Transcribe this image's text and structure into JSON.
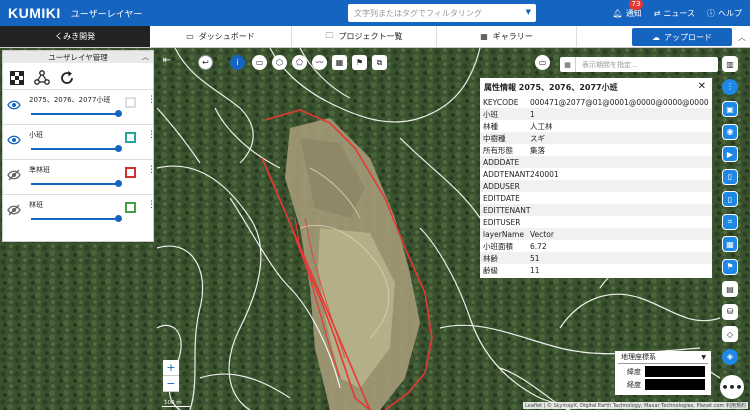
{
  "header": {
    "logo": "KUMIKI",
    "app_name": "ユーザーレイヤー",
    "search_placeholder": "文字列またはタグでフィルタリング",
    "notification_label": "通知",
    "notification_count": "73",
    "news_label": "ニュース",
    "help_label": "ヘルプ"
  },
  "nav": {
    "project": "くみき開発",
    "tabs": [
      {
        "label": "ダッシュボード",
        "icon": "monitor-icon"
      },
      {
        "label": "プロジェクト一覧",
        "icon": "folder-icon"
      },
      {
        "label": "ギャラリー",
        "icon": "grid-icon"
      }
    ],
    "upload_label": "アップロード"
  },
  "layer_panel": {
    "title": "ユーザレイヤ管理",
    "layers": [
      {
        "name": "2075、2076、2077小班",
        "visible": true,
        "color": "#dddddd",
        "opacity": 1.0
      },
      {
        "name": "小班",
        "visible": true,
        "color": "#26a69a",
        "opacity": 1.0
      },
      {
        "name": "準林班",
        "visible": false,
        "color": "#d32f2f",
        "opacity": 1.0
      },
      {
        "name": "林班",
        "visible": false,
        "color": "#43a047",
        "opacity": 1.0
      }
    ]
  },
  "map_toolbar": {
    "period_placeholder": "表示期間を指定..."
  },
  "attributes": {
    "title": "属性情報 2075、2076、2077小班",
    "rows": [
      {
        "key": "KEYCODE",
        "value": "000471@2077@01@0001@0000@0000@0000"
      },
      {
        "key": "小班",
        "value": "1"
      },
      {
        "key": "林種",
        "value": "人工林"
      },
      {
        "key": "中樹種",
        "value": "スギ"
      },
      {
        "key": "所有形態",
        "value": "集落"
      },
      {
        "key": "ADDDATE",
        "value": ""
      },
      {
        "key": "ADDTENANT",
        "value": "240001"
      },
      {
        "key": "ADDUSER",
        "value": ""
      },
      {
        "key": "EDITDATE",
        "value": ""
      },
      {
        "key": "EDITTENANT",
        "value": ""
      },
      {
        "key": "EDITUSER",
        "value": ""
      },
      {
        "key": "layerName",
        "value": "Vector"
      },
      {
        "key": "小班面積",
        "value": "6.72"
      },
      {
        "key": "林齢",
        "value": "51"
      },
      {
        "key": "齢級",
        "value": "11"
      }
    ]
  },
  "coord_box": {
    "system": "地理座標系",
    "lat_label": "緯度",
    "lon_label": "経度"
  },
  "map_footer": {
    "scale": "100 m",
    "attribution": "Leaflet | © SkymapX, Digital Earth Technology, Maxar Technologies, Planet.com 利用規約"
  },
  "colors": {
    "primary": "#1565c0",
    "boundary_red": "#e53935"
  }
}
